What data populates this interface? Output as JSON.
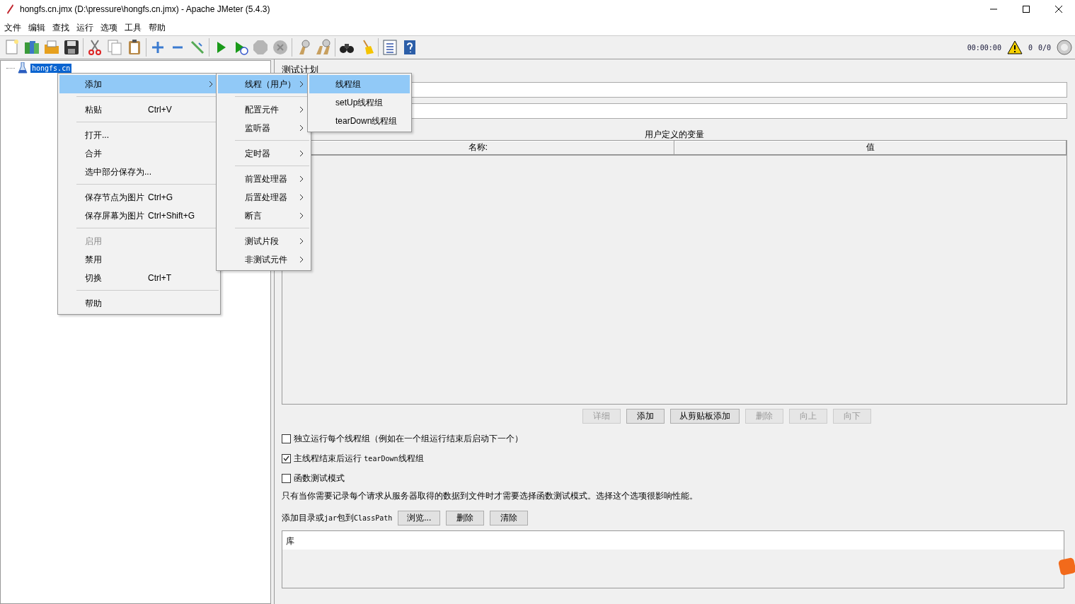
{
  "window": {
    "title": "hongfs.cn.jmx (D:\\pressure\\hongfs.cn.jmx) - Apache JMeter (5.4.3)"
  },
  "menu_bar": [
    "文件",
    "编辑",
    "查找",
    "运行",
    "选项",
    "工具",
    "帮助"
  ],
  "toolbar": {
    "elapsed": "00:00:00",
    "error_count": "0",
    "threads": "0/0"
  },
  "tree": {
    "root": {
      "label": "hongfs.cn",
      "selected": true
    }
  },
  "context_menu": {
    "items": [
      {
        "kind": "item",
        "label": "添加",
        "selected": true,
        "disabled": false,
        "submenu": true
      },
      {
        "kind": "separator"
      },
      {
        "kind": "item",
        "label": "粘贴",
        "shortcut": "Ctrl+V",
        "selected": false,
        "disabled": false,
        "submenu": false
      },
      {
        "kind": "separator"
      },
      {
        "kind": "item",
        "label": "打开...",
        "selected": false,
        "disabled": false,
        "submenu": false
      },
      {
        "kind": "item",
        "label": "合并",
        "selected": false,
        "disabled": false,
        "submenu": false
      },
      {
        "kind": "item",
        "label": "选中部分保存为...",
        "selected": false,
        "disabled": false,
        "submenu": false
      },
      {
        "kind": "separator"
      },
      {
        "kind": "item",
        "label": "保存节点为图片",
        "shortcut": "Ctrl+G",
        "selected": false,
        "disabled": false,
        "submenu": false
      },
      {
        "kind": "item",
        "label": "保存屏幕为图片",
        "shortcut": "Ctrl+Shift+G",
        "selected": false,
        "disabled": false,
        "submenu": false
      },
      {
        "kind": "separator"
      },
      {
        "kind": "item",
        "label": "启用",
        "selected": false,
        "disabled": true,
        "submenu": false
      },
      {
        "kind": "item",
        "label": "禁用",
        "selected": false,
        "disabled": false,
        "submenu": false
      },
      {
        "kind": "item",
        "label": "切换",
        "shortcut": "Ctrl+T",
        "selected": false,
        "disabled": false,
        "submenu": false
      },
      {
        "kind": "separator"
      },
      {
        "kind": "item",
        "label": "帮助",
        "selected": false,
        "disabled": false,
        "submenu": false
      }
    ]
  },
  "add_submenu": {
    "items": [
      {
        "kind": "item",
        "label": "线程（用户）",
        "selected": true,
        "disabled": false,
        "submenu": true
      },
      {
        "kind": "separator"
      },
      {
        "kind": "item",
        "label": "配置元件",
        "selected": false,
        "disabled": false,
        "submenu": true
      },
      {
        "kind": "item",
        "label": "监听器",
        "selected": false,
        "disabled": false,
        "submenu": true
      },
      {
        "kind": "separator"
      },
      {
        "kind": "item",
        "label": "定时器",
        "selected": false,
        "disabled": false,
        "submenu": true
      },
      {
        "kind": "separator"
      },
      {
        "kind": "item",
        "label": "前置处理器",
        "selected": false,
        "disabled": false,
        "submenu": true
      },
      {
        "kind": "item",
        "label": "后置处理器",
        "selected": false,
        "disabled": false,
        "submenu": true
      },
      {
        "kind": "item",
        "label": "断言",
        "selected": false,
        "disabled": false,
        "submenu": true
      },
      {
        "kind": "separator"
      },
      {
        "kind": "item",
        "label": "测试片段",
        "selected": false,
        "disabled": false,
        "submenu": true
      },
      {
        "kind": "item",
        "label": "非测试元件",
        "selected": false,
        "disabled": false,
        "submenu": true
      }
    ]
  },
  "threads_submenu": {
    "items": [
      {
        "kind": "item",
        "label": "线程组",
        "selected": true,
        "disabled": false,
        "submenu": false
      },
      {
        "kind": "item",
        "label": "setUp线程组",
        "selected": false,
        "disabled": false,
        "submenu": false
      },
      {
        "kind": "item",
        "label": "tearDown线程组",
        "selected": false,
        "disabled": false,
        "submenu": false
      }
    ]
  },
  "test_plan": {
    "title": "测试计划"
  },
  "variables_table": {
    "title": "用户定义的变量",
    "columns": [
      "名称:",
      "值"
    ]
  },
  "table_buttons": [
    {
      "label": "详细",
      "disabled": true
    },
    {
      "label": "添加",
      "disabled": false
    },
    {
      "label": "从剪贴板添加",
      "disabled": false
    },
    {
      "label": "删除",
      "disabled": true
    },
    {
      "label": "向上",
      "disabled": true
    },
    {
      "label": "向下",
      "disabled": true
    }
  ],
  "options": [
    {
      "parts": [
        {
          "kind": "sans",
          "text": "独立运行每个线程组（例如在一个组运行结束后启动下一个）"
        }
      ],
      "checked": false
    },
    {
      "parts": [
        {
          "kind": "sans",
          "text": "主线程结束后运行 "
        },
        {
          "kind": "mono",
          "text": "tearDown"
        },
        {
          "kind": "sans",
          "text": "线程组"
        }
      ],
      "checked": true
    },
    {
      "parts": [
        {
          "kind": "sans",
          "text": "函数测试模式"
        }
      ],
      "checked": false
    }
  ],
  "note": "只有当你需要记录每个请求从服务器取得的数据到文件时才需要选择函数测试模式。选择这个选项很影响性能。",
  "classpath": {
    "label_parts": [
      {
        "kind": "sans",
        "text": "添加目录或"
      },
      {
        "kind": "mono",
        "text": "jar"
      },
      {
        "kind": "sans",
        "text": "包到"
      },
      {
        "kind": "mono",
        "text": "ClassPath"
      }
    ],
    "buttons": [
      {
        "label": "浏览...",
        "disabled": false
      },
      {
        "label": "删除",
        "disabled": false
      },
      {
        "label": "清除",
        "disabled": false
      }
    ],
    "list_header": "库"
  }
}
